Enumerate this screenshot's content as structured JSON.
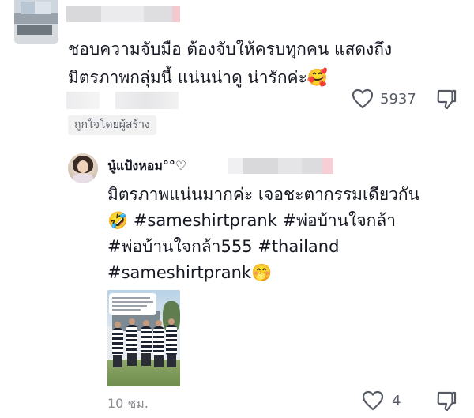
{
  "comment": {
    "text_line1": "ชอบความจับมือ ต้องจับให้ครบทุกคน แสดงถึง",
    "text_line2": "มิตรภาพกลุ่มนี้ แน่นน่าดู น่ารักค่ะ🥰",
    "like_count": "5937",
    "creator_badge": "ถูกใจโดยผู้สร้าง"
  },
  "reply": {
    "username": "นู๋แป้งหอม°°♡",
    "text_line1": "มิตรภาพแน่นมากค่ะ  เจอชะตากรรมเดียวกัน",
    "text_line2": "🤣  #sameshirtprank #พ่อบ้านใจกล้า",
    "text_line3": "#พ่อบ้านใจกล้า555 #thailand",
    "text_line4": "#sameshirtprank🤭",
    "time": "10 ชม.",
    "like_count": "4"
  },
  "colors": {
    "text": "#161823",
    "secondary": "#555a64",
    "badge_bg": "#f1f1f2"
  },
  "icons": {
    "like": "heart-outline-icon",
    "dislike": "thumbs-down-icon"
  }
}
